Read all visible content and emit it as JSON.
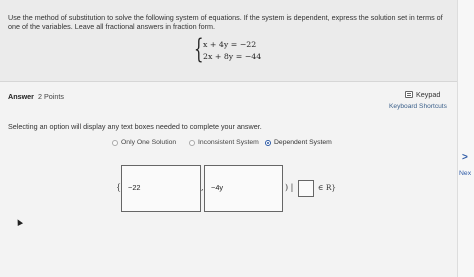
{
  "question": {
    "instructions": "Use the method of substitution to solve the following system of equations. If the system is dependent, express the solution set in terms of one of the variables. Leave all fractional answers in fraction form.",
    "equations": [
      "x + 4y = −22",
      "2x + 8y = −44"
    ]
  },
  "answer": {
    "label": "Answer",
    "points": "2 Points",
    "keypad_label": "Keypad",
    "shortcuts_label": "Keyboard Shortcuts",
    "prompt": "Selecting an option will display any text boxes needed to complete your answer.",
    "options": [
      {
        "label": "Only One Solution",
        "selected": false
      },
      {
        "label": "Inconsistent System",
        "selected": false
      },
      {
        "label": "Dependent System",
        "selected": true
      }
    ],
    "set_open": "{(",
    "box1_value": "−22",
    "separator": ",",
    "box2_value": "−4y",
    "close_paren": ") |",
    "set_close": "∈ R}"
  },
  "nav": {
    "next_arrow": ">",
    "next_label": "Nex"
  },
  "colors": {
    "accent": "#2d5aa6",
    "background": "#f3f3f3"
  }
}
